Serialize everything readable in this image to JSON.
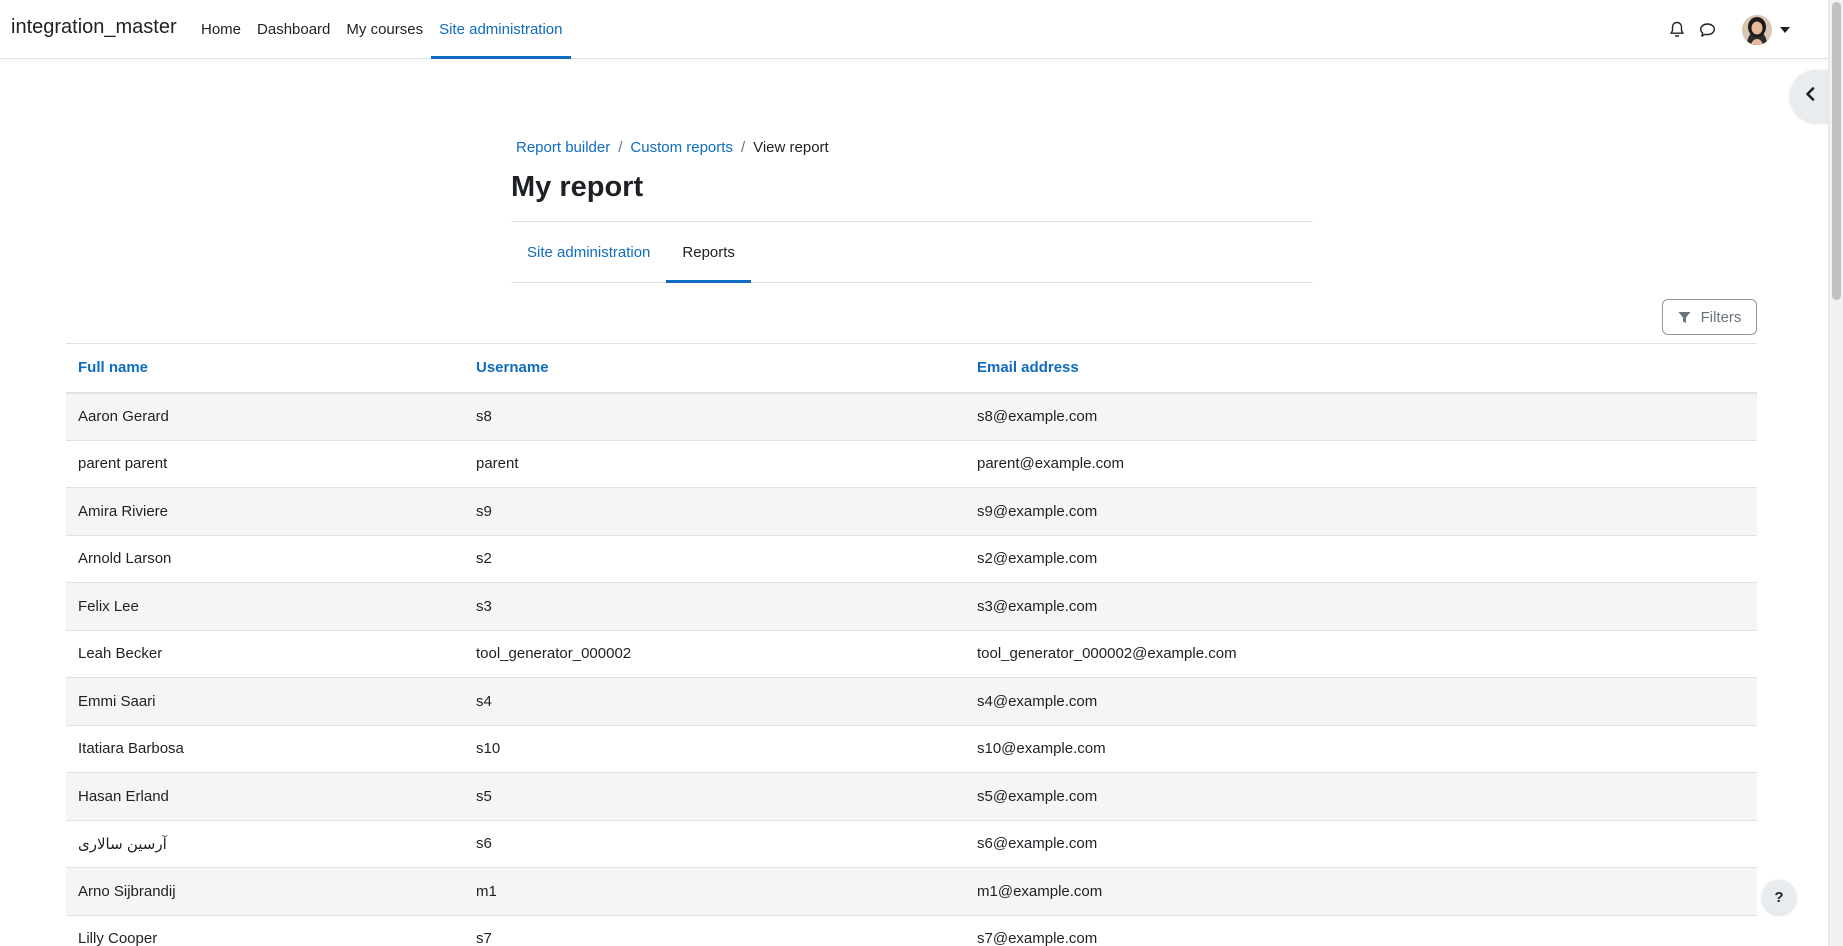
{
  "navbar": {
    "brand": "integration_master",
    "items": [
      {
        "label": "Home",
        "active": false
      },
      {
        "label": "Dashboard",
        "active": false
      },
      {
        "label": "My courses",
        "active": false
      },
      {
        "label": "Site administration",
        "active": true
      }
    ],
    "icons": [
      "bell-icon",
      "chat-icon",
      "avatar",
      "caret-down-icon"
    ]
  },
  "breadcrumb": {
    "items": [
      "Report builder",
      "Custom reports"
    ],
    "current": "View report"
  },
  "page": {
    "title": "My report"
  },
  "secondary_nav": {
    "tabs": [
      {
        "label": "Site administration",
        "active": false
      },
      {
        "label": "Reports",
        "active": true
      }
    ]
  },
  "filters": {
    "label": "Filters"
  },
  "table": {
    "headers": [
      "Full name",
      "Username",
      "Email address"
    ],
    "rows": [
      [
        "Aaron Gerard",
        "s8",
        "s8@example.com"
      ],
      [
        "parent parent",
        "parent",
        "parent@example.com"
      ],
      [
        "Amira Riviere",
        "s9",
        "s9@example.com"
      ],
      [
        "Arnold Larson",
        "s2",
        "s2@example.com"
      ],
      [
        "Felix Lee",
        "s3",
        "s3@example.com"
      ],
      [
        "Leah Becker",
        "tool_generator_000002",
        "tool_generator_000002@example.com"
      ],
      [
        "Emmi Saari",
        "s4",
        "s4@example.com"
      ],
      [
        "Itatiara Barbosa",
        "s10",
        "s10@example.com"
      ],
      [
        "Hasan Erland",
        "s5",
        "s5@example.com"
      ],
      [
        "آرسین سالاری",
        "s6",
        "s6@example.com"
      ],
      [
        "Arno Sijbrandij",
        "m1",
        "m1@example.com"
      ],
      [
        "Lilly Cooper",
        "s7",
        "s7@example.com"
      ]
    ]
  },
  "help": {
    "label": "?"
  },
  "colors": {
    "link": "#0f6cbf",
    "text": "#1d2125",
    "stripe": "#f5f5f5",
    "border": "#dee2e6"
  }
}
